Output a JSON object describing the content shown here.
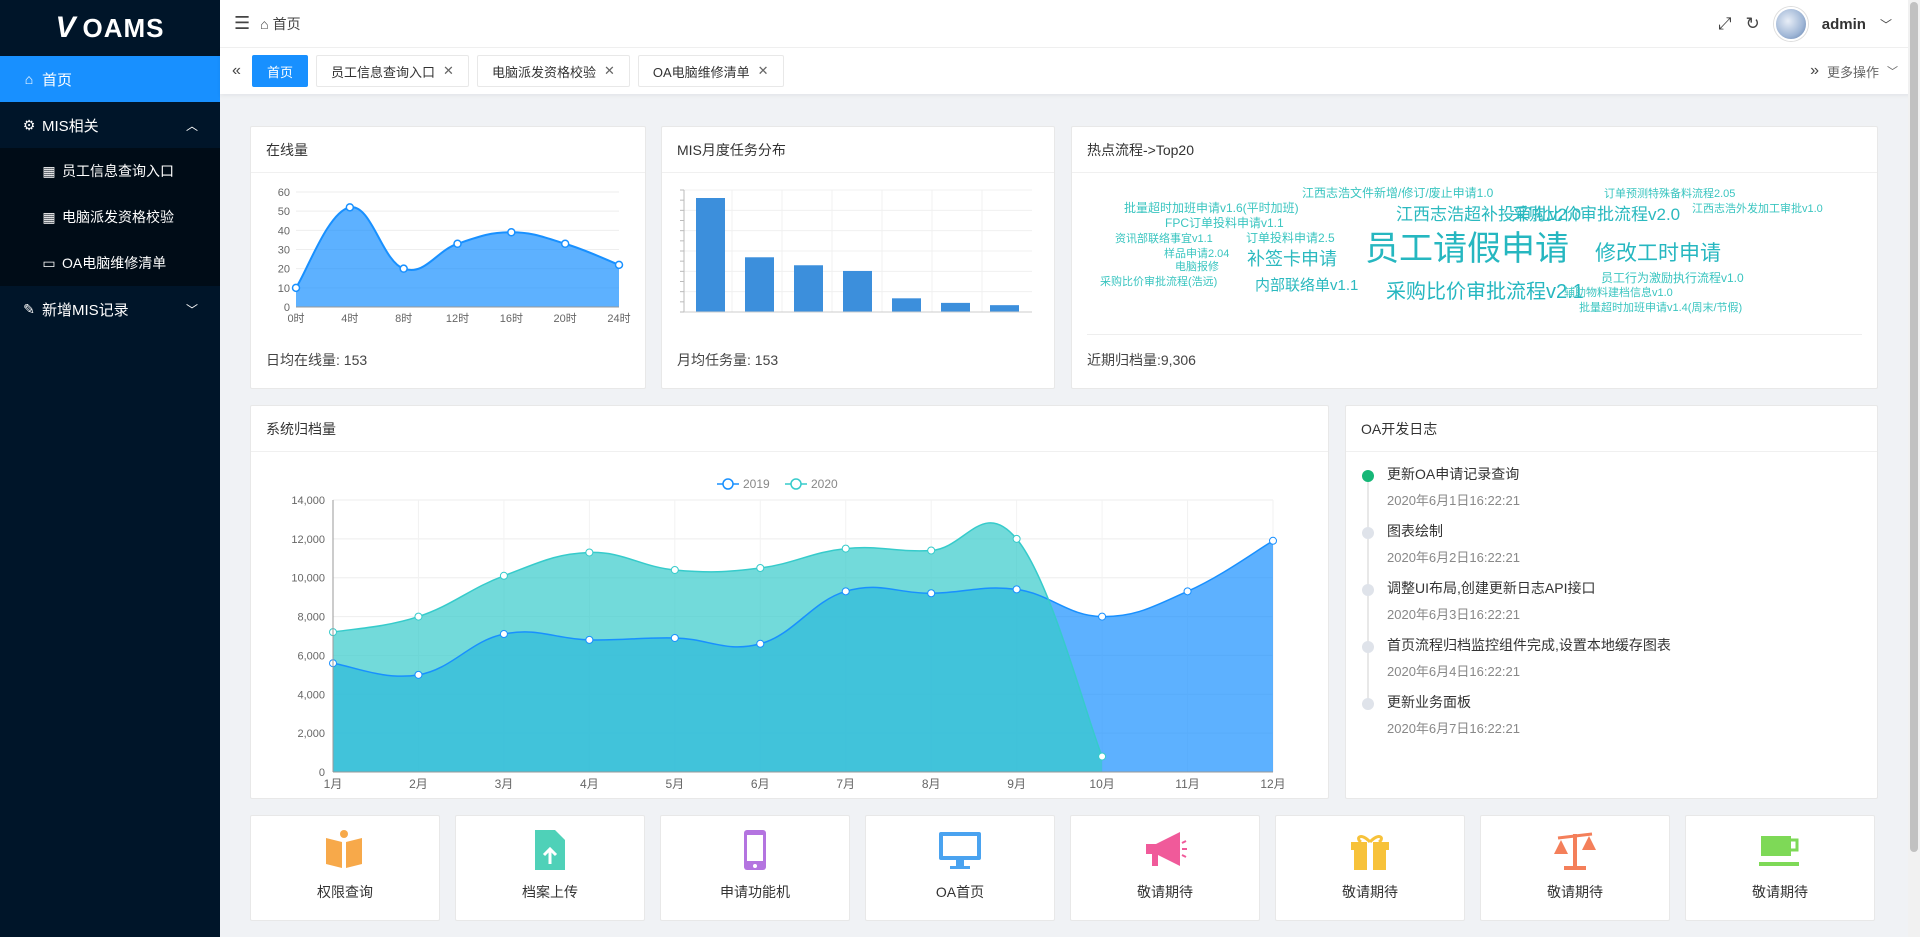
{
  "sidebar": {
    "logo_text": "OAMS",
    "items": [
      {
        "label": "首页",
        "icon": "home-icon",
        "active": true
      },
      {
        "label": "MIS相关",
        "icon": "mis-icon",
        "expanded": true,
        "children": [
          {
            "label": "员工信息查询入口",
            "icon": "cubes-icon"
          },
          {
            "label": "电脑派发资格校验",
            "icon": "cubes-icon"
          },
          {
            "label": "OA电脑维修清单",
            "icon": "laptop-icon"
          }
        ]
      },
      {
        "label": "新增MIS记录",
        "icon": "edit-icon"
      }
    ]
  },
  "header": {
    "breadcrumb": "首页",
    "username": "admin"
  },
  "tabs": {
    "items": [
      "首页",
      "员工信息查询入口",
      "电脑派发资格校验",
      "OA电脑维修清单"
    ],
    "more_label": "更多操作"
  },
  "online": {
    "title": "在线量",
    "footer": "日均在线量: 153",
    "chart_data": {
      "type": "area",
      "x": [
        "0时",
        "4时",
        "8时",
        "12时",
        "16时",
        "20时",
        "24时"
      ],
      "values": [
        10,
        52,
        20,
        33,
        39,
        33,
        22
      ],
      "ylim": [
        0,
        60
      ],
      "yticks": [
        0,
        10,
        20,
        30,
        40,
        50,
        60
      ],
      "color": "#1890ff"
    }
  },
  "monthly": {
    "title": "MIS月度任务分布",
    "footer": "月均任务量: 153",
    "chart_data": {
      "type": "bar",
      "values": [
        100,
        48,
        41,
        36,
        12,
        8,
        6
      ],
      "ylim": [
        0,
        100
      ],
      "color": "#3c8fdc"
    }
  },
  "hot": {
    "title": "热点流程->Top20",
    "footer": "近期归档量:9,306",
    "words": [
      {
        "text": "江西志浩文件新增/修订/废止申请1.0",
        "size": 12,
        "color": "#3ac5c0"
      },
      {
        "text": "订单预测特殊备料流程2.05",
        "size": 11,
        "color": "#3ac5c0"
      },
      {
        "text": "批量超时加班申请v1.6(平时加班)",
        "size": 12,
        "color": "#3ac5c0"
      },
      {
        "text": "江西志浩超补投审批v2.0",
        "size": 17,
        "color": "#2bb9bf"
      },
      {
        "text": "采购比价审批流程v2.0",
        "size": 17,
        "color": "#2bb9bf"
      },
      {
        "text": "江西志浩外发加工审批v1.0",
        "size": 11,
        "color": "#3ac5c0"
      },
      {
        "text": "FPC订单投料申请v1.1",
        "size": 12,
        "color": "#3ac5c0"
      },
      {
        "text": "资讯部联络事宜v1.1",
        "size": 11,
        "color": "#3ac5c0"
      },
      {
        "text": "订单投料申请2.5",
        "size": 12,
        "color": "#3ac5c0"
      },
      {
        "text": "样品申请2.04",
        "size": 11,
        "color": "#3ac5c0"
      },
      {
        "text": "员工请假申请",
        "size": 34,
        "color": "#26b7c0"
      },
      {
        "text": "修改工时申请",
        "size": 21,
        "color": "#26b7c0"
      },
      {
        "text": "补签卡申请",
        "size": 18,
        "color": "#2bb9bf"
      },
      {
        "text": "电脑报修",
        "size": 11,
        "color": "#3ac5c0"
      },
      {
        "text": "采购比价审批流程(浩远)",
        "size": 11,
        "color": "#3ac5c0"
      },
      {
        "text": "内部联络单v1.1",
        "size": 15,
        "color": "#2bb9bf"
      },
      {
        "text": "采购比价审批流程v2.1",
        "size": 20,
        "color": "#26b7c0"
      },
      {
        "text": "员工行为激励执行流程v1.0",
        "size": 12,
        "color": "#3ac5c0"
      },
      {
        "text": "辅助物料建档信息v1.0",
        "size": 11,
        "color": "#3ac5c0"
      },
      {
        "text": "批量超时加班申请v1.4(周末/节假)",
        "size": 11,
        "color": "#3ac5c0"
      }
    ]
  },
  "archive": {
    "title": "系统归档量",
    "chart_data": {
      "type": "area",
      "categories": [
        "1月",
        "2月",
        "3月",
        "4月",
        "5月",
        "6月",
        "7月",
        "8月",
        "9月",
        "10月",
        "11月",
        "12月"
      ],
      "ylim": [
        0,
        14000
      ],
      "yticks": [
        "0",
        "2,000",
        "4,000",
        "6,000",
        "8,000",
        "10,000",
        "12,000",
        "14,000"
      ],
      "series": [
        {
          "name": "2019",
          "color": "#1890ff",
          "values": [
            5600,
            5000,
            7100,
            6800,
            6900,
            6600,
            9300,
            9200,
            9400,
            8000,
            9300,
            11900
          ]
        },
        {
          "name": "2020",
          "color": "#36cbcb",
          "values": [
            7200,
            8000,
            10100,
            11300,
            10400,
            10500,
            11500,
            11400,
            12000,
            800,
            null,
            null
          ]
        }
      ]
    }
  },
  "devlog": {
    "title": "OA开发日志",
    "items": [
      {
        "text": "更新OA申请记录查询",
        "date": "2020年6月1日16:22:21"
      },
      {
        "text": "图表绘制",
        "date": "2020年6月2日16:22:21"
      },
      {
        "text": "调整UI布局,创建更新日志API接口",
        "date": "2020年6月3日16:22:21"
      },
      {
        "text": "首页流程归档监控组件完成,设置本地缓存图表",
        "date": "2020年6月4日16:22:21"
      },
      {
        "text": "更新业务面板",
        "date": "2020年6月7日16:22:21"
      }
    ]
  },
  "shortcuts": [
    {
      "label": "权限查询",
      "icon": "book-icon",
      "color": "#f7a94a"
    },
    {
      "label": "档案上传",
      "icon": "file-upload-icon",
      "color": "#4fd1b8"
    },
    {
      "label": "申请功能机",
      "icon": "mobile-icon",
      "color": "#b474e0"
    },
    {
      "label": "OA首页",
      "icon": "desktop-icon",
      "color": "#4aa3f0"
    },
    {
      "label": "敬请期待",
      "icon": "bullhorn-icon",
      "color": "#f05a9a"
    },
    {
      "label": "敬请期待",
      "icon": "gift-icon",
      "color": "#f7c23a"
    },
    {
      "label": "敬请期待",
      "icon": "balance-scale-icon",
      "color": "#f47f5a"
    },
    {
      "label": "敬请期待",
      "icon": "coffee-icon",
      "color": "#7ed957"
    }
  ]
}
